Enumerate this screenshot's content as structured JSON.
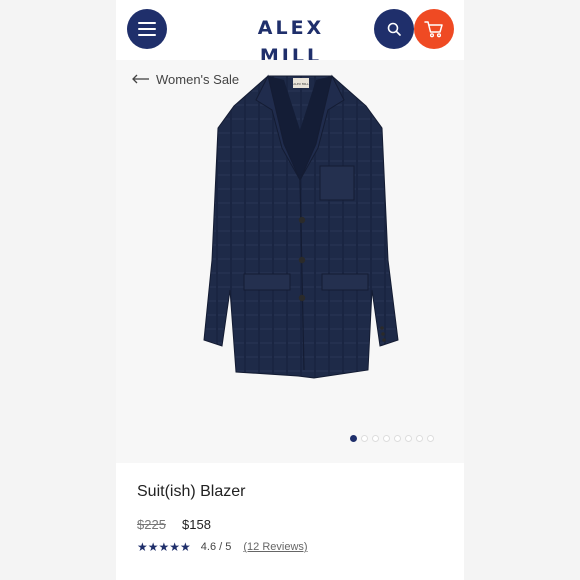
{
  "header": {
    "logo_text": "ALEX MILL",
    "menu_icon": "hamburger-icon",
    "search_icon": "search-icon",
    "cart_icon": "cart-icon",
    "colors": {
      "navy": "#1f2f6b",
      "orange": "#ef4a23"
    }
  },
  "breadcrumb": {
    "back_label": "Women's Sale"
  },
  "gallery": {
    "image_count": 8,
    "active_index": 0
  },
  "product": {
    "name": "Suit(ish) Blazer",
    "original_price": "$225",
    "sale_price": "$158",
    "stars": "★★★★★",
    "rating": "4.6 / 5",
    "reviews": "(12 Reviews)"
  }
}
